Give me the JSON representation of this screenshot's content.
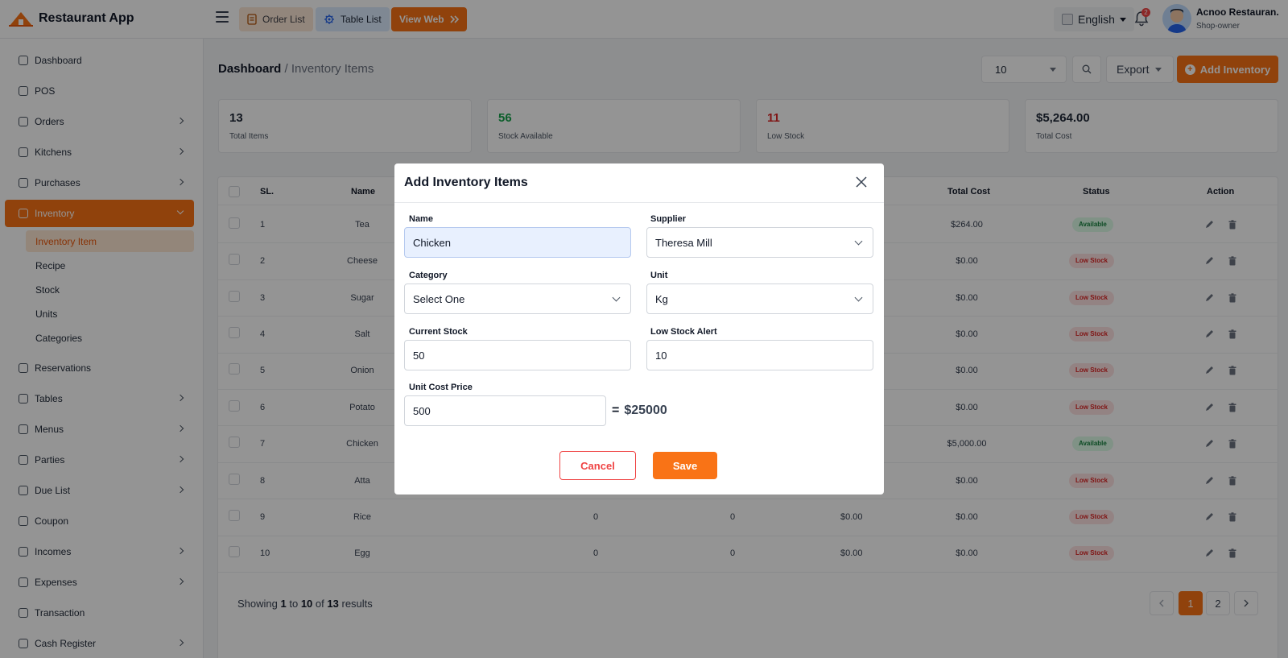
{
  "app": {
    "name": "Restaurant App"
  },
  "topbar": {
    "order_list": "Order List",
    "table_list": "Table List",
    "view_web": "View Web",
    "language": "English",
    "notif_count": "2",
    "user_name": "Acnoo Restauran.",
    "user_role": "Shop-owner"
  },
  "sidebar": {
    "items": [
      {
        "label": "Dashboard",
        "icon": "dashboard-icon"
      },
      {
        "label": "POS",
        "icon": "pos-icon"
      },
      {
        "label": "Orders",
        "icon": "orders-icon"
      },
      {
        "label": "Kitchens",
        "icon": "kitchen-icon"
      },
      {
        "label": "Purchases",
        "icon": "purchase-icon"
      },
      {
        "label": "Inventory",
        "icon": "inventory-icon"
      },
      {
        "label": "Reservations",
        "icon": "reservation-icon"
      },
      {
        "label": "Tables",
        "icon": "table-icon"
      },
      {
        "label": "Menus",
        "icon": "menu-icon"
      },
      {
        "label": "Parties",
        "icon": "parties-icon"
      },
      {
        "label": "Due List",
        "icon": "due-icon"
      },
      {
        "label": "Coupon",
        "icon": "coupon-icon"
      },
      {
        "label": "Incomes",
        "icon": "income-icon"
      },
      {
        "label": "Expenses",
        "icon": "expense-icon"
      },
      {
        "label": "Transaction",
        "icon": "transaction-icon"
      },
      {
        "label": "Cash Register",
        "icon": "cash-icon"
      }
    ],
    "inventory_sub": [
      "Inventory Item",
      "Recipe",
      "Stock",
      "Units",
      "Categories"
    ]
  },
  "breadcrumb": {
    "root": "Dashboard",
    "current": "/ Inventory Items"
  },
  "controls": {
    "per_page": "10",
    "export": "Export",
    "add": "Add Inventory"
  },
  "stats": [
    {
      "value": "13",
      "label": "Total Items",
      "color": "#111827"
    },
    {
      "value": "56",
      "label": "Stock Available",
      "color": "#16a34a"
    },
    {
      "value": "11",
      "label": "Low Stock",
      "color": "#dc2626"
    },
    {
      "value": "$5,264.00",
      "label": "Total Cost",
      "color": "#111827"
    }
  ],
  "table": {
    "headers": {
      "sl": "SL.",
      "name": "Name",
      "total_cost": "Total Cost",
      "status": "Status",
      "action": "Action"
    },
    "rows": [
      {
        "sl": "1",
        "name": "Tea",
        "total_cost": "$264.00",
        "status": "Available"
      },
      {
        "sl": "2",
        "name": "Cheese",
        "total_cost": "$0.00",
        "status": "Low Stock"
      },
      {
        "sl": "3",
        "name": "Sugar",
        "total_cost": "$0.00",
        "status": "Low Stock"
      },
      {
        "sl": "4",
        "name": "Salt",
        "total_cost": "$0.00",
        "status": "Low Stock"
      },
      {
        "sl": "5",
        "name": "Onion",
        "total_cost": "$0.00",
        "status": "Low Stock"
      },
      {
        "sl": "6",
        "name": "Potato",
        "total_cost": "$0.00",
        "status": "Low Stock"
      },
      {
        "sl": "7",
        "name": "Chicken",
        "total_cost": "$5,000.00",
        "status": "Available"
      },
      {
        "sl": "8",
        "name": "Atta",
        "total_cost": "$0.00",
        "status": "Low Stock"
      },
      {
        "sl": "9",
        "name": "Rice",
        "c1": "0",
        "c2": "0",
        "c3": "$0.00",
        "total_cost": "$0.00",
        "status": "Low Stock"
      },
      {
        "sl": "10",
        "name": "Egg",
        "c1": "0",
        "c2": "0",
        "c3": "$0.00",
        "total_cost": "$0.00",
        "status": "Low Stock"
      }
    ]
  },
  "pagination": {
    "text_showing": "Showing",
    "from": "1",
    "text_to": "to",
    "to": "10",
    "text_of": "of",
    "total": "13",
    "text_results": "results",
    "pages": [
      "1",
      "2"
    ]
  },
  "modal": {
    "title": "Add Inventory Items",
    "name_label": "Name",
    "name_value": "Chicken",
    "supplier_label": "Supplier",
    "supplier_value": "Theresa Mill",
    "category_label": "Category",
    "category_value": "Select One",
    "unit_label": "Unit",
    "unit_value": "Kg",
    "current_stock_label": "Current Stock",
    "current_stock_value": "50",
    "low_stock_label": "Low Stock Alert",
    "low_stock_value": "10",
    "unit_cost_label": "Unit Cost Price",
    "unit_cost_value": "500",
    "equals": "=",
    "total_value": "$25000",
    "cancel": "Cancel",
    "save": "Save"
  },
  "colors": {
    "accent": "#f97316",
    "available": "#15803d",
    "low": "#dc2626"
  }
}
